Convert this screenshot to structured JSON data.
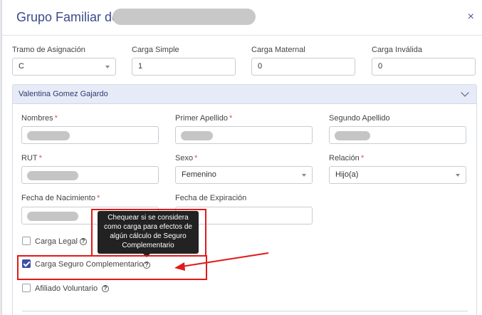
{
  "modal": {
    "title": "Grupo Familiar de",
    "close_glyph": "×"
  },
  "top_fields": {
    "tramo_label": "Tramo de Asignación",
    "tramo_value": "C",
    "simple_label": "Carga Simple",
    "simple_value": "1",
    "maternal_label": "Carga Maternal",
    "maternal_value": "0",
    "invalida_label": "Carga Inválida",
    "invalida_value": "0"
  },
  "member": {
    "name": "Valentina Gomez Gajardo",
    "nombres_label": "Nombres",
    "primer_apellido_label": "Primer Apellido",
    "segundo_apellido_label": "Segundo Apellido",
    "rut_label": "RUT",
    "sexo_label": "Sexo",
    "sexo_value": "Femenino",
    "relacion_label": "Relación",
    "relacion_value": "Hijo(a)",
    "fecha_nac_label": "Fecha de Nacimiento",
    "fecha_exp_label": "Fecha de Expiración",
    "required_mark": "*"
  },
  "checkboxes": {
    "carga_legal_label": "Carga Legal",
    "carga_legal_checked": false,
    "seguro_label": "Carga Seguro Complementario",
    "seguro_checked": true,
    "afiliado_label": "Afiliado Voluntario",
    "afiliado_checked": false,
    "help_glyph": "?"
  },
  "tooltip": {
    "text": "Chequear si se considera como carga para efectos de algún cálculo de Seguro Complementario"
  },
  "colors": {
    "accent": "#3a50a8",
    "annotation_red": "#e01a1a",
    "title": "#3a4b8c"
  }
}
